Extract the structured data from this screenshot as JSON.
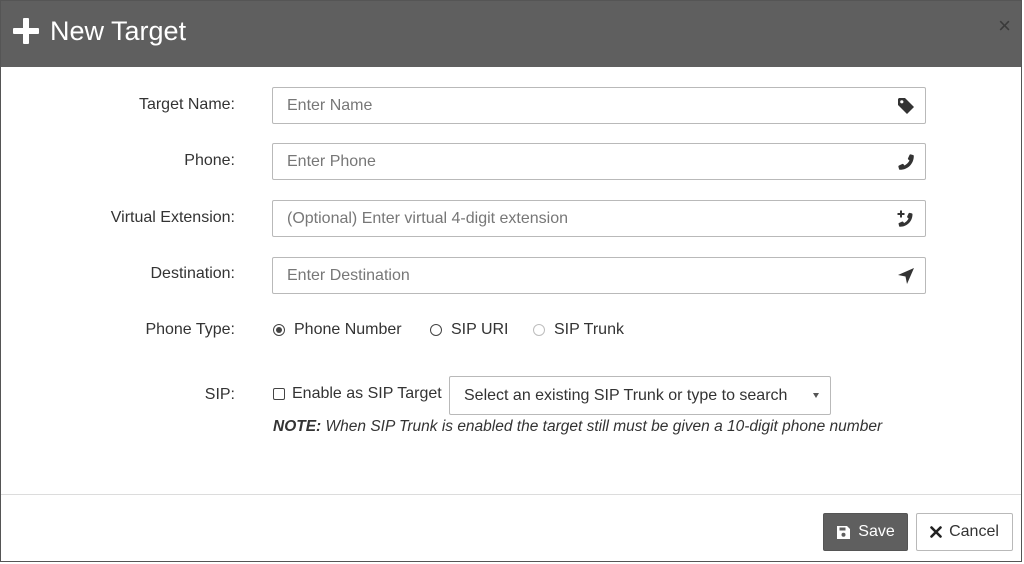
{
  "header": {
    "title": "New Target",
    "close_glyph": "×"
  },
  "form": {
    "target_name": {
      "label": "Target Name:",
      "placeholder": "Enter Name",
      "value": "",
      "icon": "tag-icon"
    },
    "phone": {
      "label": "Phone:",
      "placeholder": "Enter Phone",
      "value": "",
      "icon": "phone-icon"
    },
    "virtual_extension": {
      "label": "Virtual Extension:",
      "placeholder": "(Optional) Enter virtual 4-digit extension",
      "value": "",
      "icon": "phone-plus-icon"
    },
    "destination": {
      "label": "Destination:",
      "placeholder": "Enter Destination",
      "value": "",
      "icon": "location-arrow-icon"
    },
    "phone_type": {
      "label": "Phone Type:",
      "options": [
        {
          "label": "Phone Number",
          "selected": true,
          "disabled": false
        },
        {
          "label": "SIP URI",
          "selected": false,
          "disabled": false
        },
        {
          "label": "SIP Trunk",
          "selected": false,
          "disabled": true
        }
      ]
    },
    "sip": {
      "label": "SIP:",
      "checkbox_label": "Enable as SIP Target",
      "checked": false,
      "select_text": "Select an existing SIP Trunk or type to search",
      "note_prefix": "NOTE:",
      "note_text": " When SIP Trunk is enabled the target still must be given a 10-digit phone number"
    }
  },
  "footer": {
    "save_label": "Save",
    "cancel_label": "Cancel"
  },
  "colors": {
    "header_bg": "#5f5f5f",
    "save_bg": "#5f5f5f",
    "border": "#b9b9b9"
  }
}
